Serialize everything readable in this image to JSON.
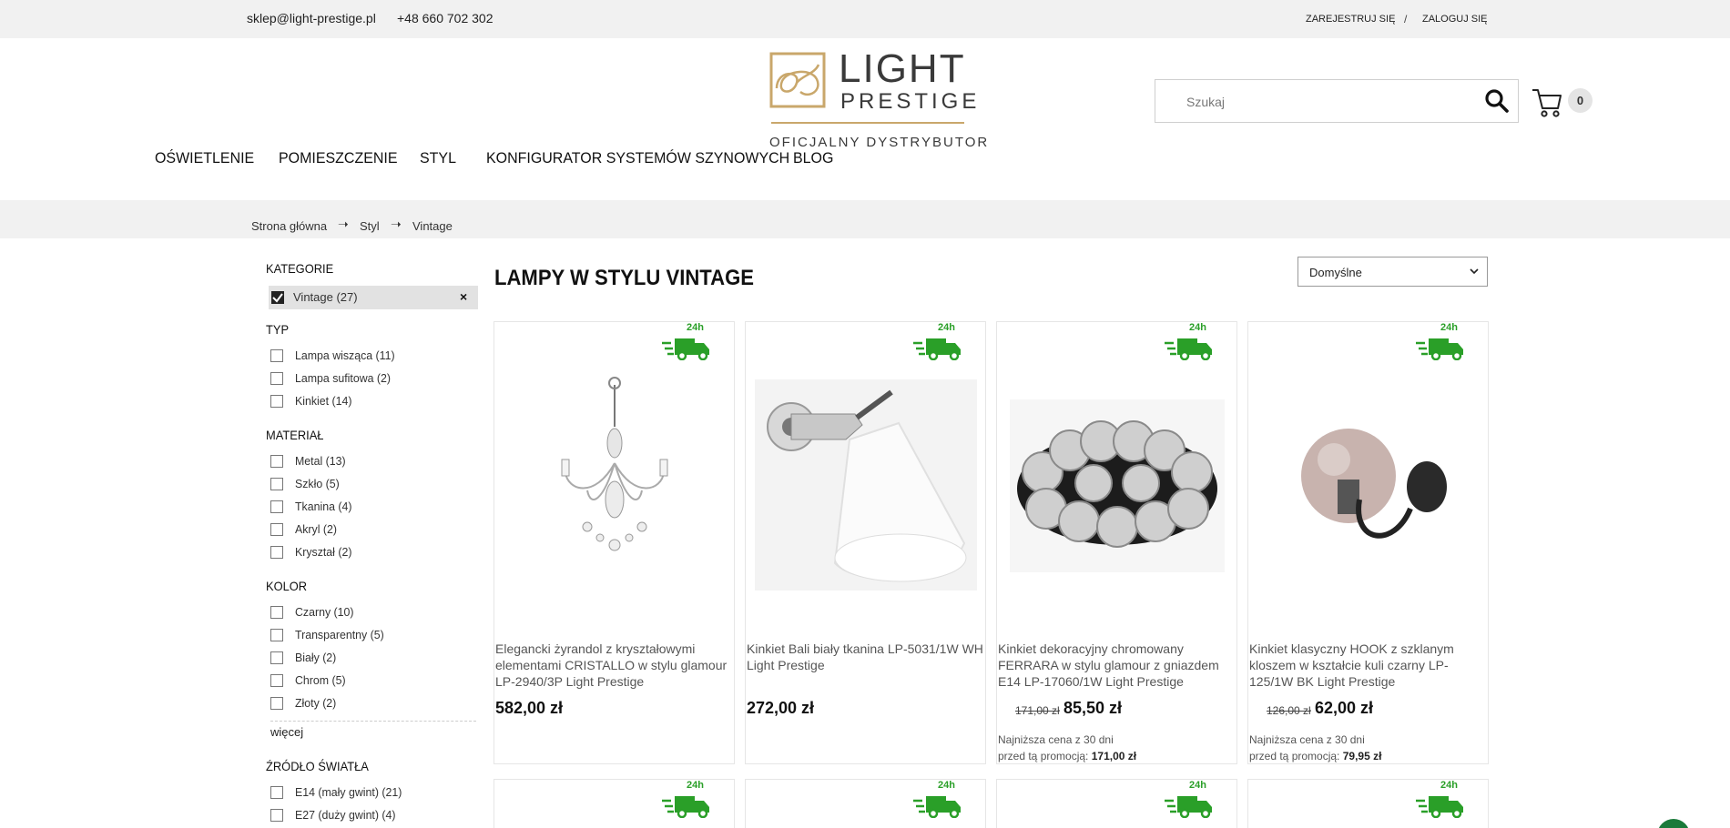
{
  "topbar": {
    "email": "sklep@light-prestige.pl",
    "phone": "+48 660 702 302",
    "register": "ZAREJESTRUJ SIĘ",
    "separator": "/",
    "login": "ZALOGUJ SIĘ"
  },
  "logo": {
    "line1": "LIGHT",
    "line2": "PRESTIGE",
    "tagline": "OFICJALNY DYSTRYBUTOR",
    "gold": "#c9a76b"
  },
  "search": {
    "placeholder": "Szukaj"
  },
  "cart": {
    "count": "0"
  },
  "nav": [
    {
      "label": "OŚWIETLENIE"
    },
    {
      "label": "POMIESZCZENIE"
    },
    {
      "label": "STYL"
    },
    {
      "label": "KONFIGURATOR SYSTEMÓW SZYNOWYCH"
    },
    {
      "label": "BLOG"
    }
  ],
  "breadcrumb": [
    {
      "label": "Strona główna"
    },
    {
      "label": "Styl"
    },
    {
      "label": "Vintage"
    }
  ],
  "sidebar": {
    "kategorie": {
      "title": "KATEGORIE",
      "active": "Vintage (27)",
      "remove": "×"
    },
    "typ": {
      "title": "TYP",
      "options": [
        "Lampa wisząca (11)",
        "Lampa sufitowa (2)",
        "Kinkiet (14)"
      ]
    },
    "material": {
      "title": "MATERIAŁ",
      "options": [
        "Metal (13)",
        "Szkło (5)",
        "Tkanina (4)",
        "Akryl (2)",
        "Kryształ (2)"
      ]
    },
    "kolor": {
      "title": "KOLOR",
      "options": [
        "Czarny (10)",
        "Transparentny (5)",
        "Biały (2)",
        "Chrom (5)",
        "Złoty (2)"
      ],
      "more": "więcej"
    },
    "zrodlo": {
      "title": "ŹRÓDŁO ŚWIATŁA",
      "options": [
        "E14 (mały gwint) (21)",
        "E27 (duży gwint) (4)"
      ]
    }
  },
  "main": {
    "title": "LAMPY W STYLU VINTAGE",
    "sort": "Domyślne",
    "badge": "24h",
    "products": [
      {
        "name": "Elegancki żyrandol z kryształowymi elementami CRISTALLO w stylu glamour LP-2940/3P Light Prestige",
        "price": "582,00 zł"
      },
      {
        "name": "Kinkiet Bali biały tkanina LP-5031/1W WH Light Prestige",
        "price": "272,00 zł"
      },
      {
        "name": "Kinkiet dekoracyjny chromowany FERRARA w stylu glamour z gniazdem E14 LP-17060/1W Light Prestige",
        "old_price": "171,00 zł",
        "new_price": "85,50 zł",
        "lowest_label": "Najniższa cena z 30 dni",
        "promo_label": "przed tą promocją:",
        "promo_value": "171,00 zł"
      },
      {
        "name": "Kinkiet klasyczny HOOK z szklanym kloszem w kształcie kuli czarny LP-125/1W BK Light Prestige",
        "old_price": "126,00 zł",
        "new_price": "62,00 zł",
        "lowest_label": "Najniższa cena z 30 dni",
        "promo_label": "przed tą promocją:",
        "promo_value": "79,95 zł"
      }
    ]
  },
  "colors": {
    "delivery_green": "#2a9f28",
    "topbar_bg": "#f1f1f1"
  }
}
